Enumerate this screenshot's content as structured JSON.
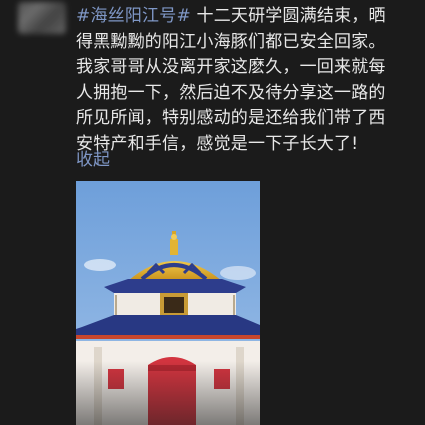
{
  "post": {
    "hashtag": "#海丝阳江号#",
    "lines": [
      " 十二天研学圆满结束，晒",
      "得黑黝黝的阳江小海豚们都已安全回家。",
      "我家哥哥从没离开家这麽久，一回来就每",
      "人拥抱一下，然后迫不及待分享这一路的",
      "所见所闻，特别感动的是还给我们带了西",
      "安特产和手信，感觉是一下子长大了!"
    ],
    "collapse_label": "收起"
  },
  "photo": {
    "subject": "pagoda-building",
    "sky_color": "#6e9fda",
    "dome_color": "#e4b52a",
    "roof_color": "#2d3d8c",
    "wall_color": "#f3eee9",
    "door_color": "#d2343f"
  }
}
